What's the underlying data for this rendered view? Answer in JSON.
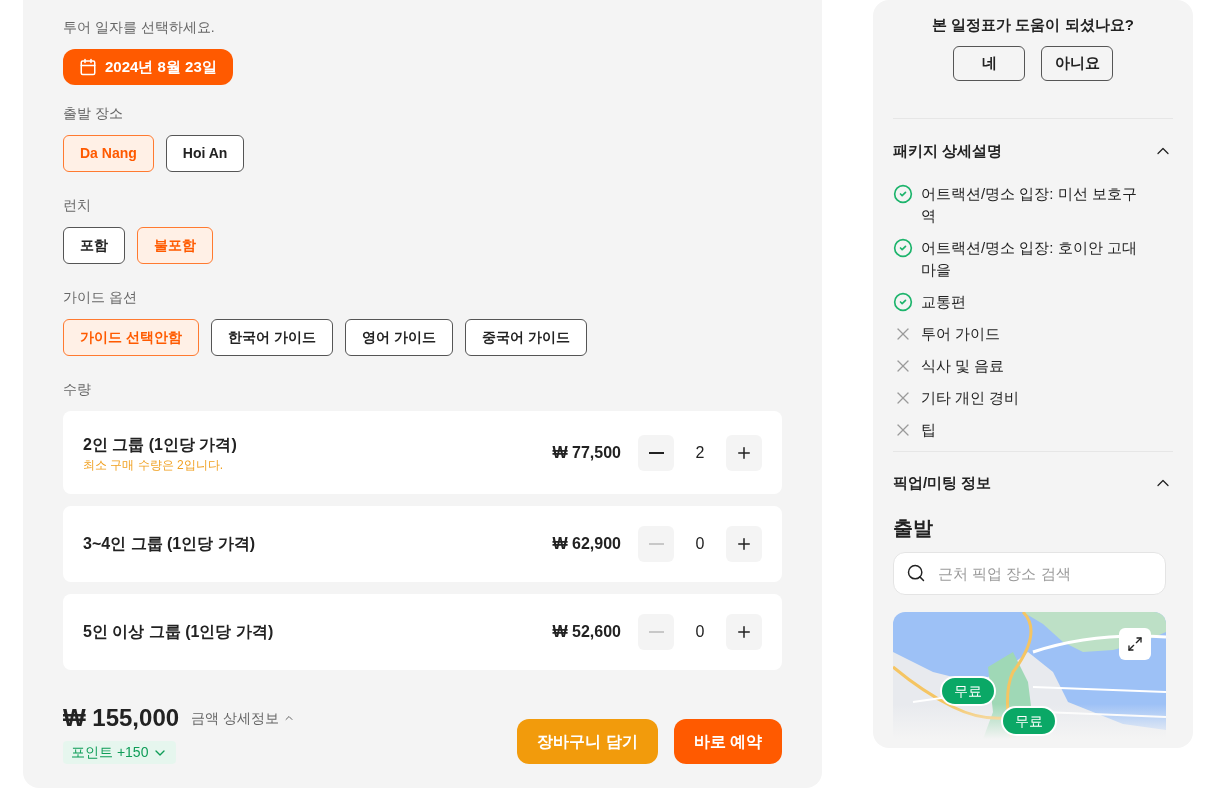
{
  "date_picker": {
    "label": "투어 일자를 선택하세요.",
    "value": "2024년 8월 23일"
  },
  "option_groups": [
    {
      "label": "출발 장소",
      "options": [
        {
          "label": "Da Nang",
          "selected": true
        },
        {
          "label": "Hoi An",
          "selected": false
        }
      ]
    },
    {
      "label": "런치",
      "options": [
        {
          "label": "포함",
          "selected": false
        },
        {
          "label": "불포함",
          "selected": true
        }
      ]
    },
    {
      "label": "가이드 옵션",
      "options": [
        {
          "label": "가이드 선택안함",
          "selected": true
        },
        {
          "label": "한국어 가이드",
          "selected": false
        },
        {
          "label": "영어 가이드",
          "selected": false
        },
        {
          "label": "중국어 가이드",
          "selected": false
        }
      ]
    }
  ],
  "quantity": {
    "label": "수량",
    "rows": [
      {
        "name": "2인 그룹 (1인당 가격)",
        "note": "최소 구매 수량은 2입니다.",
        "price": "₩ 77,500",
        "count": "2",
        "decrease_disabled": false
      },
      {
        "name": "3~4인 그룹 (1인당 가격)",
        "price": "₩ 62,900",
        "count": "0",
        "decrease_disabled": true
      },
      {
        "name": "5인 이상 그룹 (1인당 가격)",
        "price": "₩ 52,600",
        "count": "0",
        "decrease_disabled": true
      }
    ]
  },
  "total": {
    "amount": "₩ 155,000",
    "details_link": "금액 상세정보",
    "points": "포인트 +150"
  },
  "actions": [
    {
      "label": "장바구니 담기",
      "kind": "cart"
    },
    {
      "label": "바로 예약",
      "kind": "book"
    }
  ],
  "sidebar": {
    "feedback": {
      "question": "본 일정표가 도움이 되셨나요?",
      "buttons": [
        "네",
        "아니요"
      ]
    },
    "package": {
      "title": "패키지 상세설명",
      "expanded": true,
      "items": [
        {
          "text": "어트랙션/명소 입장: 미선 보호구역",
          "included": true
        },
        {
          "text": "어트랙션/명소 입장: 호이안 고대마을",
          "included": true
        },
        {
          "text": "교통편",
          "included": true
        },
        {
          "text": "투어 가이드",
          "included": false
        },
        {
          "text": "식사 및 음료",
          "included": false
        },
        {
          "text": "기타 개인 경비",
          "included": false
        },
        {
          "text": "팁",
          "included": false
        }
      ]
    },
    "pickup": {
      "title": "픽업/미팅 정보",
      "expanded": true,
      "subtitle": "출발",
      "search": {
        "placeholder": "근처 픽업 장소 검색"
      },
      "map": {
        "markers": [
          "무료",
          "무료"
        ]
      }
    }
  }
}
